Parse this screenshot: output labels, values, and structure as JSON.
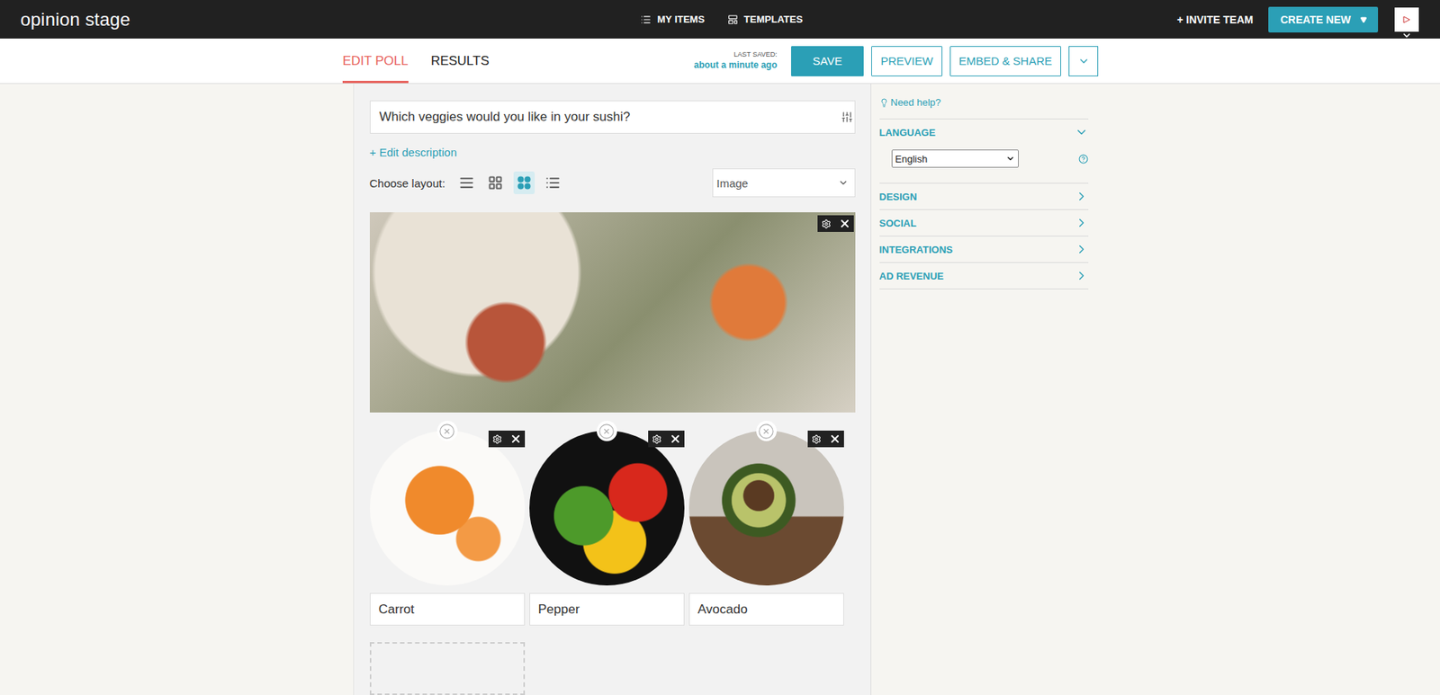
{
  "app": {
    "logo": "opinion stage"
  },
  "nav": [
    {
      "label": "MY ITEMS",
      "kind": "list"
    },
    {
      "label": "TEMPLATES",
      "kind": "templates"
    }
  ],
  "header_actions": {
    "invite": "+ INVITE TEAM",
    "create": "CREATE NEW"
  },
  "tabs": [
    {
      "label": "EDIT POLL",
      "selected": true
    },
    {
      "label": "RESULTS",
      "selected": false
    }
  ],
  "last_saved": {
    "label": "LAST SAVED:",
    "time": "about a minute ago"
  },
  "toolbar_buttons": [
    {
      "label": "SAVE",
      "primary": true
    },
    {
      "label": "PREVIEW",
      "primary": false
    },
    {
      "label": "EMBED & SHARE",
      "primary": false
    }
  ],
  "poll": {
    "question": "Which veggies would you like in your sushi?",
    "edit_description": "+ Edit description",
    "layout_label": "Choose layout:",
    "layouts": [
      {
        "kind": "rows",
        "selected": false
      },
      {
        "kind": "grid",
        "selected": false
      },
      {
        "kind": "circles",
        "selected": true
      },
      {
        "kind": "list",
        "selected": false
      }
    ],
    "media_type": "Image",
    "options": [
      {
        "label": "Carrot"
      },
      {
        "label": "Pepper"
      },
      {
        "label": "Avocado"
      }
    ]
  },
  "sidebar": {
    "help": "Need help?",
    "sections": [
      {
        "title": "LANGUAGE",
        "expanded": true
      },
      {
        "title": "DESIGN",
        "expanded": false
      },
      {
        "title": "SOCIAL",
        "expanded": false
      },
      {
        "title": "INTEGRATIONS",
        "expanded": false
      },
      {
        "title": "AD REVENUE",
        "expanded": false
      }
    ],
    "language": "English"
  }
}
